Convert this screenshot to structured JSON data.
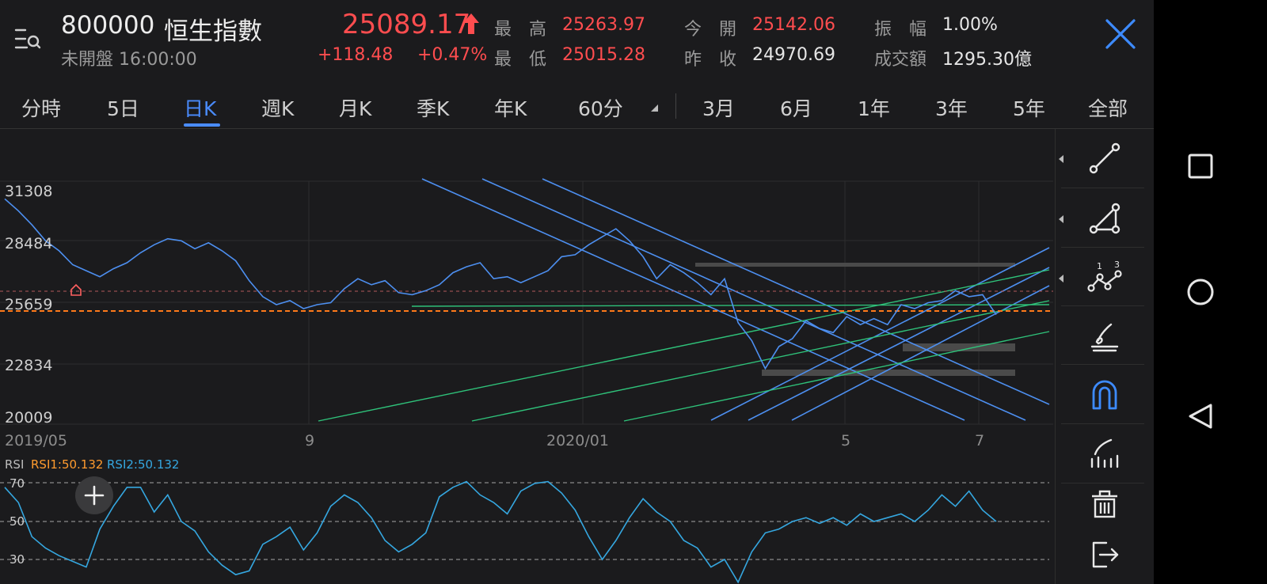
{
  "header": {
    "code": "800000",
    "name": "恒生指數",
    "status": "未開盤 16:00:00",
    "price": "25089.17",
    "change": "+118.48",
    "change_pct": "+0.47%",
    "high_label": "最　高",
    "high": "25263.97",
    "low_label": "最　低",
    "low": "25015.28",
    "open_label": "今　開",
    "open": "25142.06",
    "prev_label": "昨　收",
    "prev": "24970.69",
    "amp_label": "振　幅",
    "amp": "1.00%",
    "turnover_label": "成交額",
    "turnover": "1295.30億"
  },
  "tabs": [
    "分時",
    "5日",
    "日K",
    "週K",
    "月K",
    "季K",
    "年K",
    "60分",
    "3月",
    "6月",
    "1年",
    "3年",
    "5年",
    "全部"
  ],
  "active_tab": "日K",
  "main_chart": {
    "y_ticks": [
      "31308",
      "28484",
      "25659",
      "22834",
      "20009"
    ],
    "x_ticks": [
      "2019/05",
      "9",
      "2020/01",
      "5",
      "7"
    ],
    "current_price_line": 25089.17,
    "prev_close_line": 26200
  },
  "rsi": {
    "title": "RSI",
    "rsi1": "RSI1:50.132",
    "rsi2": "RSI2:50.132",
    "levels": [
      "70",
      "50",
      "30"
    ]
  },
  "chart_data": {
    "type": "line",
    "title": "",
    "ylim": [
      20009,
      31308
    ],
    "series": [
      {
        "name": "",
        "values": [
          30900,
          30300,
          29600,
          28800,
          28300,
          27600,
          27300,
          27000,
          27400,
          27700,
          28200,
          28600,
          28900,
          28800,
          28400,
          28700,
          28300,
          27800,
          26800,
          26000,
          25600,
          25800,
          25400,
          25600,
          25700,
          26400,
          26900,
          26600,
          26800,
          26200,
          26100,
          26300,
          26600,
          27200,
          27500,
          27700,
          26900,
          27000,
          26700,
          27000,
          27300,
          28000,
          28100,
          28600,
          29000,
          29400,
          28800,
          28000,
          26900,
          27600,
          27200,
          26700,
          26100,
          26900,
          24700,
          23800,
          22400,
          23500,
          23900,
          24800,
          24400,
          24200,
          25000,
          24600,
          24900,
          24600,
          25600,
          25400,
          25700,
          25800,
          26300,
          26000,
          26100,
          25100
        ]
      }
    ],
    "rsi_series": [
      {
        "name": "RSI1",
        "values": [
          68,
          60,
          42,
          36,
          32,
          29,
          26,
          46,
          58,
          68,
          68,
          55,
          64,
          50,
          45,
          34,
          27,
          22,
          24,
          38,
          42,
          47,
          35,
          44,
          58,
          64,
          60,
          52,
          40,
          34,
          38,
          44,
          63,
          68,
          71,
          64,
          60,
          54,
          66,
          70,
          71,
          65,
          56,
          42,
          30,
          40,
          52,
          62,
          55,
          50,
          40,
          36,
          26,
          30,
          18,
          34,
          44,
          46,
          50,
          52,
          49,
          52,
          48,
          54,
          50,
          52,
          54,
          50,
          56,
          64,
          58,
          66,
          56,
          50
        ]
      }
    ]
  },
  "toolbar": [
    "line-tool",
    "triangle-tool",
    "wave-tool",
    "brush-tool",
    "magnet-tool",
    "fib-tool",
    "trash-tool",
    "exit-tool"
  ],
  "nav": [
    "square",
    "circle",
    "triangle"
  ]
}
